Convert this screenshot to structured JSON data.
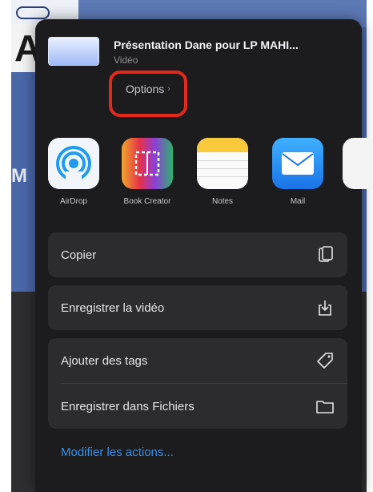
{
  "sheet": {
    "title": "Présentation Dane pour LP MAHI...",
    "subtitle": "Vidéo",
    "options_label": "Options",
    "options_chevron": "›"
  },
  "apps": [
    {
      "label": "AirDrop",
      "icon": "airdrop-icon"
    },
    {
      "label": "Book Creator",
      "icon": "book-creator-icon"
    },
    {
      "label": "Notes",
      "icon": "notes-icon"
    },
    {
      "label": "Mail",
      "icon": "mail-icon"
    }
  ],
  "actions": {
    "copy": "Copier",
    "save_video": "Enregistrer la vidéo",
    "add_tags": "Ajouter des tags",
    "save_files": "Enregistrer dans Fichiers"
  },
  "edit_actions": "Modifier les actions...",
  "background": {
    "logo": "A",
    "side_letter": "M"
  },
  "colors": {
    "highlight": "#e6281a",
    "link": "#3a8ee6",
    "sheet": "#1c1c1e"
  }
}
